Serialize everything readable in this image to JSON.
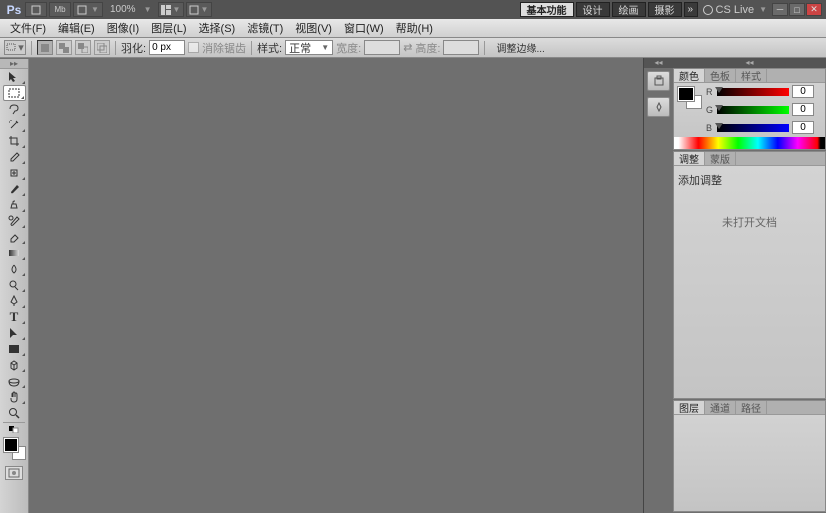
{
  "topbar": {
    "logo": "Ps",
    "zoom": "100%",
    "workspaces": [
      "基本功能",
      "设计",
      "绘画",
      "摄影"
    ],
    "active_ws": 0,
    "more": "»",
    "cslive": "CS Live"
  },
  "menu": [
    "文件(F)",
    "编辑(E)",
    "图像(I)",
    "图层(L)",
    "选择(S)",
    "滤镜(T)",
    "视图(V)",
    "窗口(W)",
    "帮助(H)"
  ],
  "options": {
    "feather_label": "羽化:",
    "feather_value": "0 px",
    "antialias": "消除锯齿",
    "style_label": "样式:",
    "style_value": "正常",
    "width_label": "宽度:",
    "height_label": "高度:",
    "refine": "调整边缘..."
  },
  "color_panel": {
    "tabs": [
      "颜色",
      "色板",
      "样式"
    ],
    "channels": [
      {
        "name": "R",
        "value": "0"
      },
      {
        "name": "G",
        "value": "0"
      },
      {
        "name": "B",
        "value": "0"
      }
    ]
  },
  "adjust_panel": {
    "tabs": [
      "调整",
      "蒙版"
    ],
    "add_label": "添加调整",
    "no_open": "未打开文档"
  },
  "layers_panel": {
    "tabs": [
      "图层",
      "通道",
      "路径"
    ]
  }
}
